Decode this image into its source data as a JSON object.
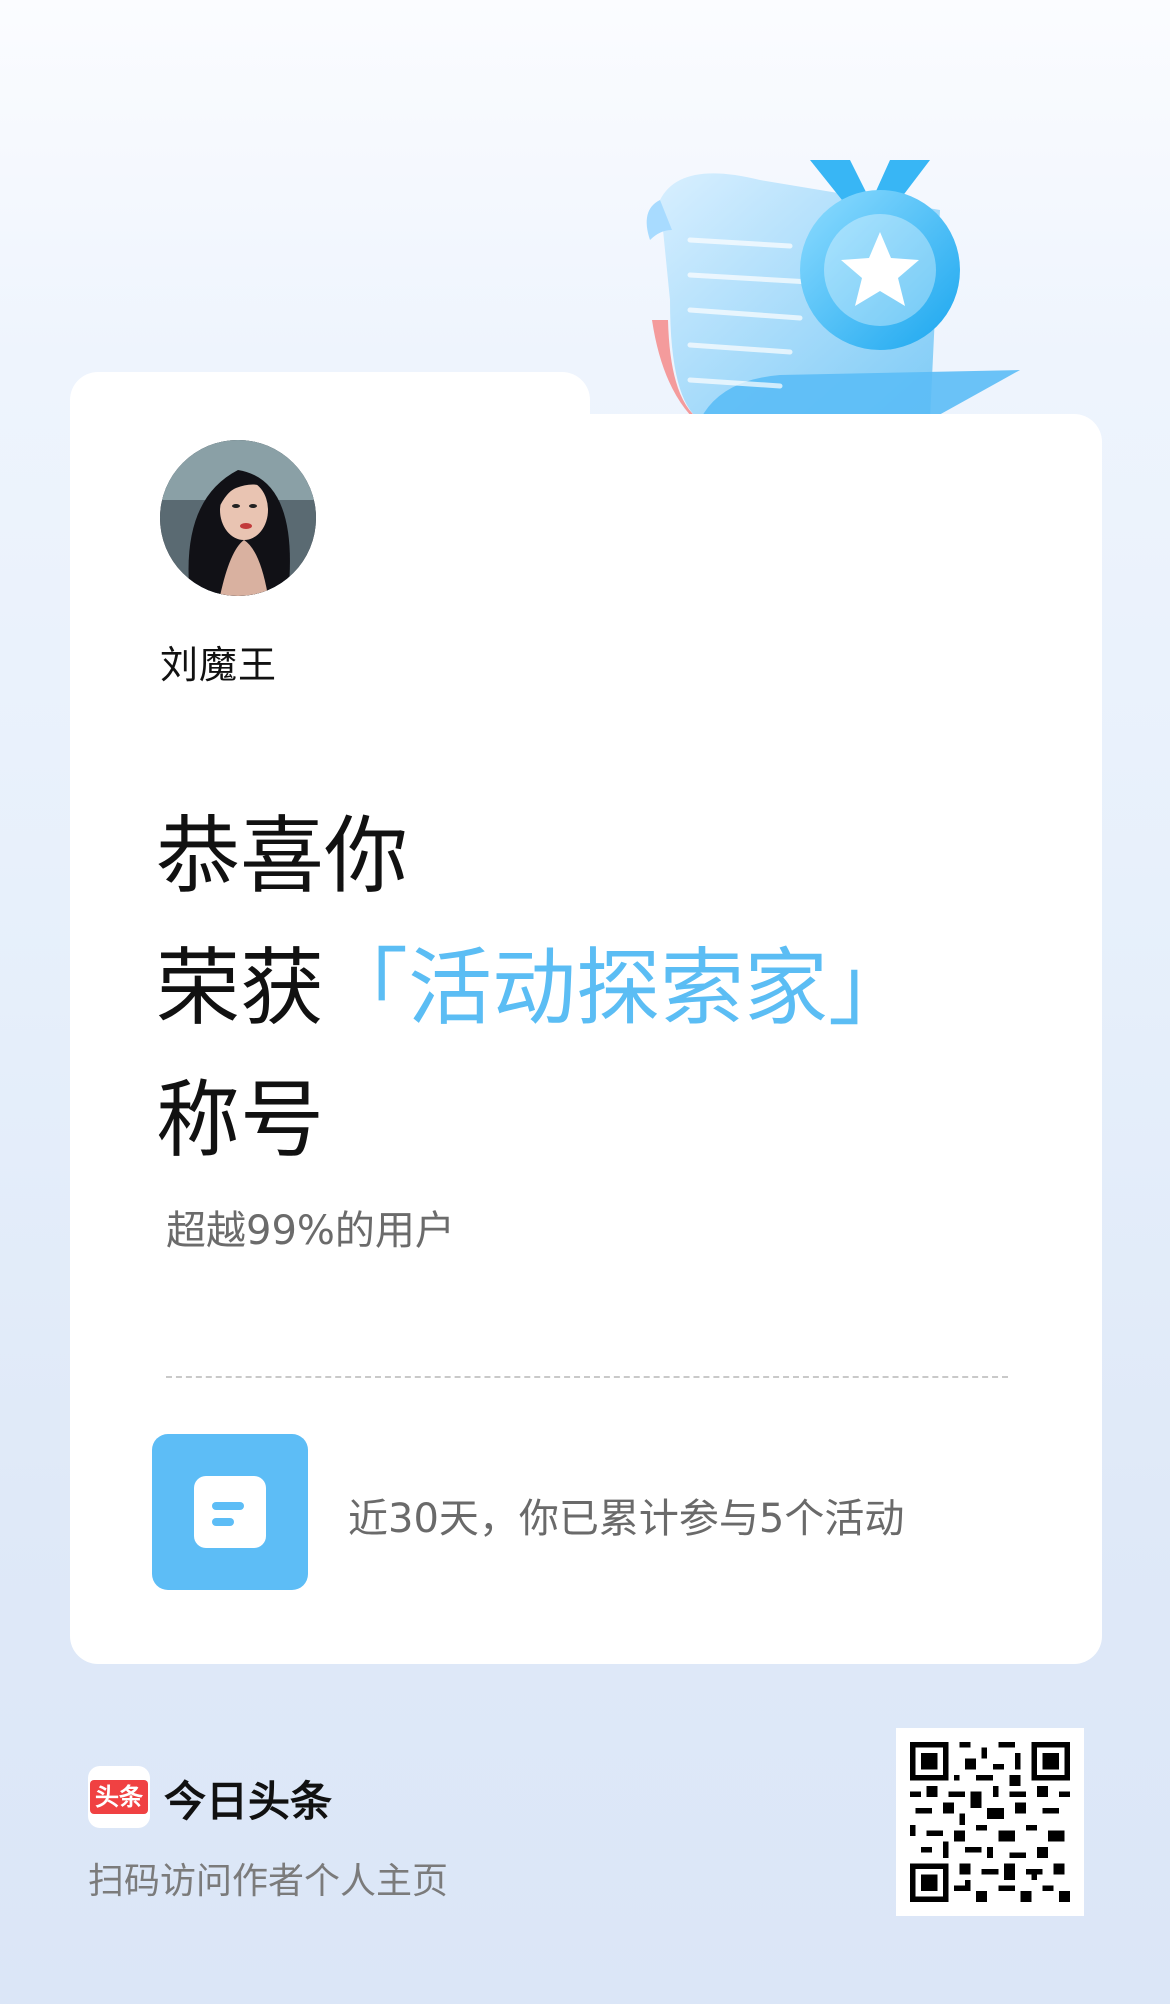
{
  "profile": {
    "username": "刘魔王"
  },
  "achievement": {
    "line1": "恭喜你",
    "line2_prefix": "荣获",
    "title": "「活动探索家」",
    "line3": "称号",
    "percentile_text": "超越99%的用户"
  },
  "activity": {
    "summary": "近30天，你已累计参与5个活动"
  },
  "footer": {
    "logo_badge": "头条",
    "app_name": "今日头条",
    "tip": "扫码访问作者个人主页"
  },
  "icons": {
    "medal": "medal-scroll-icon",
    "activity": "document-icon",
    "qr": "qr-code"
  },
  "colors": {
    "accent": "#5bbdf4",
    "brand_red": "#f04142"
  }
}
